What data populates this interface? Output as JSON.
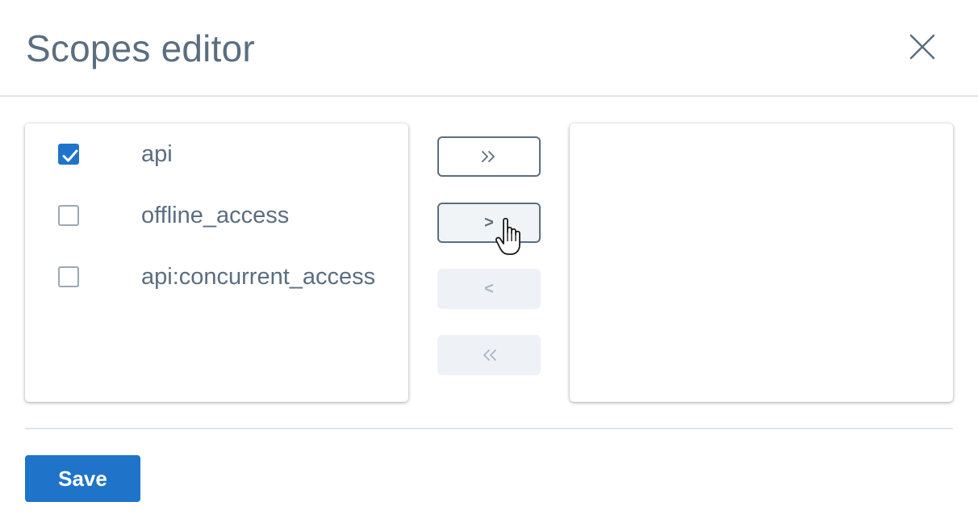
{
  "dialog": {
    "title": "Scopes editor",
    "close_icon": "close-icon"
  },
  "available_scopes": [
    {
      "label": "api",
      "checked": true
    },
    {
      "label": "offline_access",
      "checked": false
    },
    {
      "label": "api:concurrent_access",
      "checked": false
    }
  ],
  "selected_scopes": [],
  "transfer_buttons": {
    "move_all_right": {
      "label": "≫",
      "enabled": true
    },
    "move_right": {
      "label": ">",
      "enabled": true
    },
    "move_left": {
      "label": "<",
      "enabled": false
    },
    "move_all_left": {
      "label": "≪",
      "enabled": false
    }
  },
  "footer": {
    "save_label": "Save"
  },
  "colors": {
    "accent": "#1f74c9",
    "text": "#5b6e80",
    "divider": "#dce6ee",
    "disabled_bg": "#eef2f6",
    "disabled_text": "#a9b7c4"
  }
}
